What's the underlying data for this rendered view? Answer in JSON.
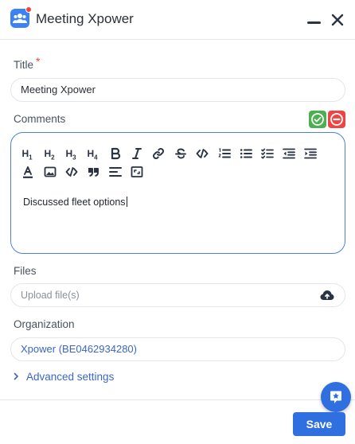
{
  "header": {
    "title": "Meeting Xpower",
    "app_icon": "people-icon",
    "notification_color": "#ef4444"
  },
  "form": {
    "title_label": "Title",
    "required_mark": "*",
    "title_value": "Meeting Xpower",
    "comments_label": "Comments",
    "comments_toggles": [
      "check-icon",
      "minus-circle-icon"
    ],
    "toolbar": {
      "headings": [
        {
          "text": "H",
          "level": "1"
        },
        {
          "text": "H",
          "level": "2"
        },
        {
          "text": "H",
          "level": "3"
        },
        {
          "text": "H",
          "level": "4"
        }
      ],
      "buttons_row1": [
        "bold-icon",
        "italic-icon",
        "link-icon",
        "strikethrough-icon",
        "code-icon",
        "ordered-list-icon",
        "bullet-list-icon",
        "task-list-icon",
        "outdent-icon",
        "indent-icon"
      ],
      "buttons_row2": [
        "text-color-icon",
        "image-icon",
        "code-block-icon",
        "quote-icon",
        "align-left-icon",
        "fullscreen-icon"
      ]
    },
    "comment_text": "Discussed fleet options",
    "files_label": "Files",
    "files_placeholder": "Upload file(s)",
    "organization_label": "Organization",
    "organization_value": "Xpower (BE0462934280)",
    "advanced_settings": "Advanced settings"
  },
  "footer": {
    "save_label": "Save"
  },
  "colors": {
    "primary": "#2f6fe0",
    "link": "#3b66c4",
    "accept": "#4caf50",
    "reject": "#ef4444"
  }
}
